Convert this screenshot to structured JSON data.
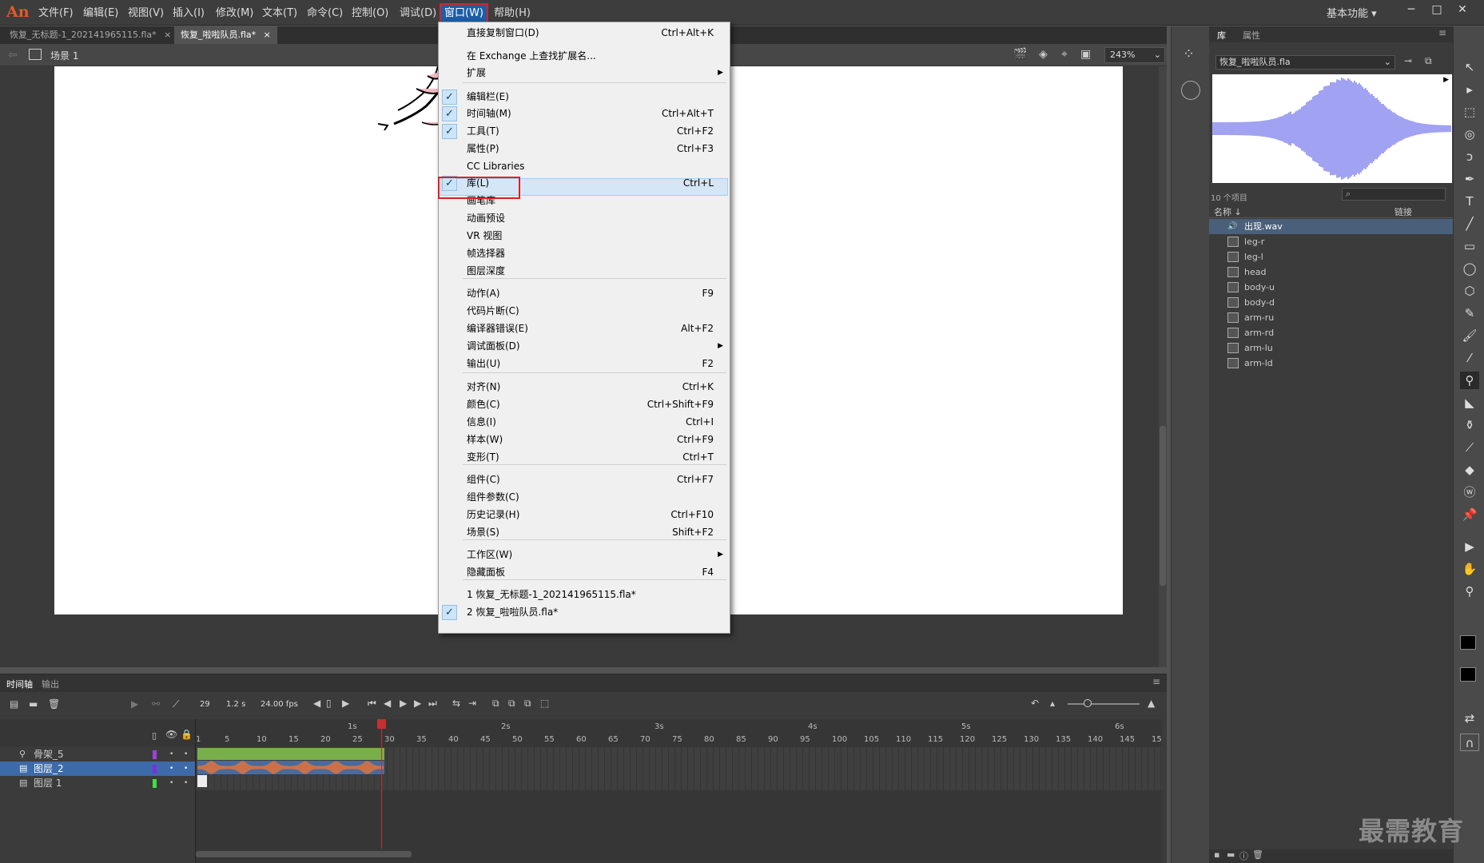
{
  "app": {
    "logo": "An",
    "workspace": "基本功能 ▾"
  },
  "menubar": [
    {
      "id": "file",
      "label": "文件(F)"
    },
    {
      "id": "edit",
      "label": "编辑(E)"
    },
    {
      "id": "view",
      "label": "视图(V)"
    },
    {
      "id": "insert",
      "label": "插入(I)"
    },
    {
      "id": "modify",
      "label": "修改(M)"
    },
    {
      "id": "text",
      "label": "文本(T)"
    },
    {
      "id": "command",
      "label": "命令(C)"
    },
    {
      "id": "control",
      "label": "控制(O)"
    },
    {
      "id": "debug",
      "label": "调试(D)"
    },
    {
      "id": "window",
      "label": "窗口(W)"
    },
    {
      "id": "help",
      "label": "帮助(H)"
    }
  ],
  "doc_tabs": [
    {
      "label": "恢复_无标题-1_202141965115.fla*",
      "close": "×"
    },
    {
      "label": "恢复_啦啦队员.fla*",
      "close": "×"
    }
  ],
  "editbar": {
    "scene": "场景 1",
    "zoom": "243%"
  },
  "window_menu": {
    "rows": [
      {
        "label": "直接复制窗口(D)",
        "shortcut": "Ctrl+Alt+K",
        "checked": false
      },
      {
        "label": "在 Exchange 上查找扩展名...",
        "shortcut": "",
        "checked": false
      },
      {
        "label": "扩展",
        "shortcut": "",
        "checked": false,
        "submenu": true
      },
      {
        "label": "编辑栏(E)",
        "shortcut": "",
        "checked": true
      },
      {
        "label": "时间轴(M)",
        "shortcut": "Ctrl+Alt+T",
        "checked": true
      },
      {
        "label": "工具(T)",
        "shortcut": "Ctrl+F2",
        "checked": true
      },
      {
        "label": "属性(P)",
        "shortcut": "Ctrl+F3",
        "checked": false
      },
      {
        "label": "CC Libraries",
        "shortcut": "",
        "checked": false
      },
      {
        "label": "库(L)",
        "shortcut": "Ctrl+L",
        "checked": true
      },
      {
        "label": "画笔库",
        "shortcut": "",
        "checked": false
      },
      {
        "label": "动画预设",
        "shortcut": "",
        "checked": false
      },
      {
        "label": "VR 视图",
        "shortcut": "",
        "checked": false
      },
      {
        "label": "帧选择器",
        "shortcut": "",
        "checked": false
      },
      {
        "label": "图层深度",
        "shortcut": "",
        "checked": false
      },
      {
        "label": "动作(A)",
        "shortcut": "F9",
        "checked": false
      },
      {
        "label": "代码片断(C)",
        "shortcut": "",
        "checked": false
      },
      {
        "label": "编译器错误(E)",
        "shortcut": "Alt+F2",
        "checked": false
      },
      {
        "label": "调试面板(D)",
        "shortcut": "",
        "checked": false,
        "submenu": true
      },
      {
        "label": "输出(U)",
        "shortcut": "F2",
        "checked": false
      },
      {
        "label": "对齐(N)",
        "shortcut": "Ctrl+K",
        "checked": false
      },
      {
        "label": "颜色(C)",
        "shortcut": "Ctrl+Shift+F9",
        "checked": false
      },
      {
        "label": "信息(I)",
        "shortcut": "Ctrl+I",
        "checked": false
      },
      {
        "label": "样本(W)",
        "shortcut": "Ctrl+F9",
        "checked": false
      },
      {
        "label": "变形(T)",
        "shortcut": "Ctrl+T",
        "checked": false
      },
      {
        "label": "组件(C)",
        "shortcut": "Ctrl+F7",
        "checked": false
      },
      {
        "label": "组件参数(C)",
        "shortcut": "",
        "checked": false
      },
      {
        "label": "历史记录(H)",
        "shortcut": "Ctrl+F10",
        "checked": false
      },
      {
        "label": "场景(S)",
        "shortcut": "Shift+F2",
        "checked": false
      },
      {
        "label": "工作区(W)",
        "shortcut": "",
        "checked": false,
        "submenu": true
      },
      {
        "label": "隐藏面板",
        "shortcut": "F4",
        "checked": false
      },
      {
        "label": "1 恢复_无标题-1_202141965115.fla*",
        "shortcut": "",
        "checked": false
      },
      {
        "label": "2 恢复_啦啦队员.fla*",
        "shortcut": "",
        "checked": true
      }
    ]
  },
  "library": {
    "tabs": [
      "库",
      "属性"
    ],
    "document": "恢复_啦啦队员.fla",
    "item_count": "10 个项目",
    "col_name": "名称 ↓",
    "col_link": "链接",
    "items": [
      "出现.wav",
      "leg-r",
      "leg-l",
      "head",
      "body-u",
      "body-d",
      "arm-ru",
      "arm-rd",
      "arm-lu",
      "arm-ld"
    ]
  },
  "timeline": {
    "tabs": [
      "时间轴",
      "输出"
    ],
    "frame": "29",
    "time": "1.2 s",
    "fps": "24.00 fps",
    "seconds": [
      "1s",
      "2s",
      "3s",
      "4s",
      "5s",
      "6s"
    ],
    "ruler": [
      "1",
      "5",
      "10",
      "15",
      "20",
      "25",
      "30",
      "35",
      "40",
      "45",
      "50",
      "55",
      "60",
      "65",
      "70",
      "75",
      "80",
      "85",
      "90",
      "95",
      "100",
      "105",
      "110",
      "115",
      "120",
      "125",
      "130",
      "135",
      "140",
      "145",
      "15"
    ],
    "layers": [
      {
        "name": "骨架_5",
        "color": "#a040e0"
      },
      {
        "name": "图层_2",
        "color": "#7a30e0"
      },
      {
        "name": "图层 1",
        "color": "#40e040"
      }
    ]
  },
  "watermark": "最需教育"
}
